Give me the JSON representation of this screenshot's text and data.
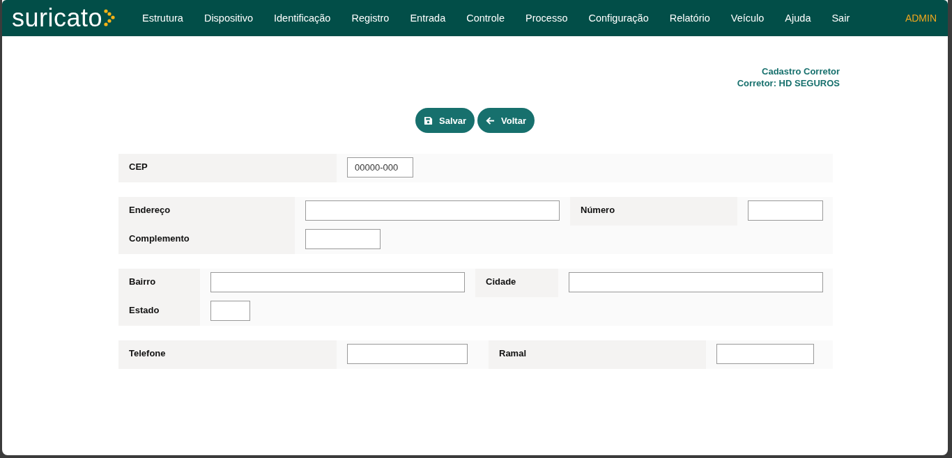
{
  "brand": {
    "logo_text": "suricato"
  },
  "menu": [
    {
      "label": "Estrutura"
    },
    {
      "label": "Dispositivo"
    },
    {
      "label": "Identificação"
    },
    {
      "label": "Registro"
    },
    {
      "label": "Entrada"
    },
    {
      "label": "Controle"
    },
    {
      "label": "Processo"
    },
    {
      "label": "Configuração"
    },
    {
      "label": "Relatório"
    },
    {
      "label": "Veículo"
    },
    {
      "label": "Ajuda"
    },
    {
      "label": "Sair"
    }
  ],
  "user": "ADMIN",
  "page_title": [
    "Cadastro Corretor",
    "Corretor: HD SEGUROS"
  ],
  "buttons": [
    {
      "label": "Salvar",
      "kind": "save"
    },
    {
      "label": "Voltar",
      "kind": "back"
    }
  ],
  "sections": [
    {
      "rows": [
        [
          {
            "label": "CEP",
            "placeholder": "00000-000"
          }
        ]
      ]
    },
    {
      "rows": [
        [
          {
            "label": "Endereço"
          },
          {
            "label": "Número"
          }
        ],
        [
          {
            "label": "Complemento"
          }
        ]
      ]
    },
    {
      "rows": [
        [
          {
            "label": "Bairro"
          },
          {
            "label": "Cidade"
          }
        ],
        [
          {
            "label": "Estado"
          }
        ]
      ]
    },
    {
      "rows": [
        [
          {
            "label": "Telefone"
          },
          {
            "label": "Ramal"
          }
        ]
      ]
    }
  ]
}
